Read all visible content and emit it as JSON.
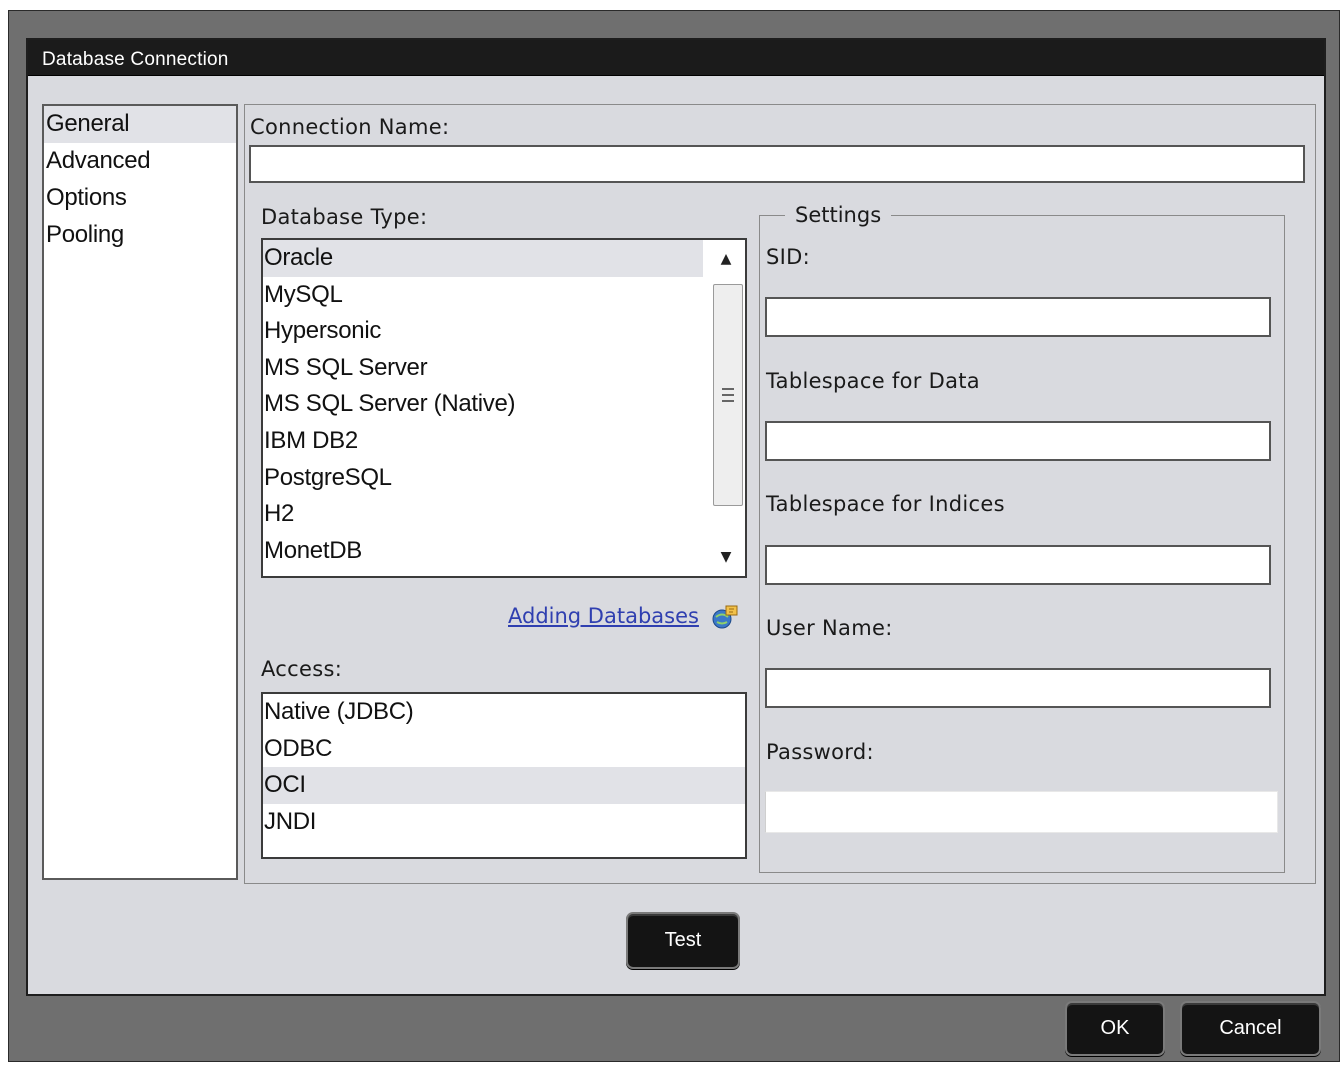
{
  "window": {
    "title": "Database Connection"
  },
  "nav": {
    "items": [
      {
        "label": "General",
        "selected": true
      },
      {
        "label": "Advanced",
        "selected": false
      },
      {
        "label": "Options",
        "selected": false
      },
      {
        "label": "Pooling",
        "selected": false
      }
    ]
  },
  "general": {
    "connection_name_label": "Connection Name:",
    "connection_name_value": "",
    "database_type_label": "Database Type:",
    "database_types": [
      {
        "label": "Oracle",
        "selected": true
      },
      {
        "label": "MySQL",
        "selected": false
      },
      {
        "label": "Hypersonic",
        "selected": false
      },
      {
        "label": "MS SQL Server",
        "selected": false
      },
      {
        "label": "MS SQL Server (Native)",
        "selected": false
      },
      {
        "label": "IBM DB2",
        "selected": false
      },
      {
        "label": "PostgreSQL",
        "selected": false
      },
      {
        "label": "H2",
        "selected": false
      },
      {
        "label": "MonetDB",
        "selected": false
      }
    ],
    "adding_databases_link": "Adding Databases",
    "access_label": "Access:",
    "access_types": [
      {
        "label": "Native (JDBC)",
        "selected": false
      },
      {
        "label": "ODBC",
        "selected": false
      },
      {
        "label": "OCI",
        "selected": true
      },
      {
        "label": "JNDI",
        "selected": false
      }
    ]
  },
  "settings": {
    "legend": "Settings",
    "sid_label": "SID:",
    "sid_value": "",
    "tablespace_data_label": "Tablespace for Data",
    "tablespace_data_value": "",
    "tablespace_indices_label": "Tablespace for Indices",
    "tablespace_indices_value": "",
    "user_name_label": "User Name:",
    "user_name_value": "",
    "password_label": "Password:",
    "password_value": ""
  },
  "buttons": {
    "test": "Test",
    "ok": "OK",
    "cancel": "Cancel"
  },
  "icons": {
    "scroll_up": "scroll-up-arrow-icon",
    "scroll_down": "scroll-down-arrow-icon",
    "help_link": "help-link-icon"
  }
}
